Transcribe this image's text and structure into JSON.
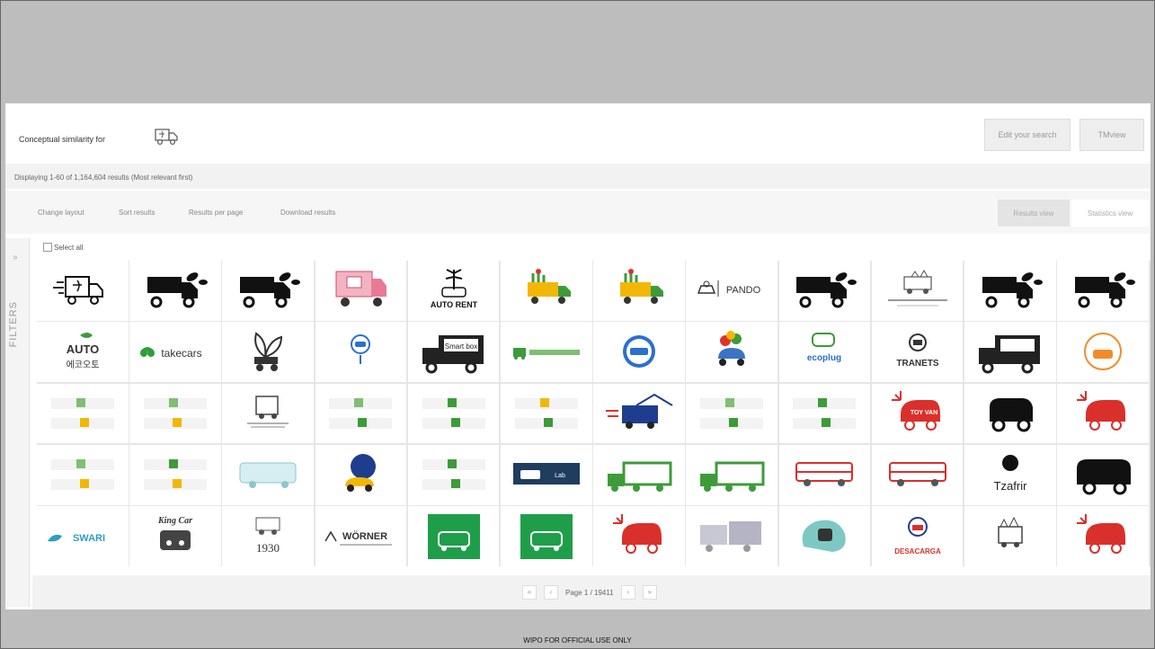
{
  "similarity": {
    "label": "Conceptual similarity for",
    "edit_button": "Edit your search",
    "tmview_button": "TMview"
  },
  "results": {
    "summary": "Displaying 1-60 of 1,164,604 results (Most relevant first)"
  },
  "toolbar": {
    "change_layout": "Change layout",
    "sort_results": "Sort results",
    "results_per_page": "Results per page",
    "download_results": "Download results",
    "results_view": "Results view",
    "statistics_view": "Statistics view"
  },
  "filters": {
    "label": "FILTERS",
    "chevron": "»"
  },
  "select_all": "Select all",
  "grid": {
    "logo_texts": {
      "pando": "PANDO",
      "takecars": "takecars",
      "auto": "AUTO",
      "auto_korean": "에코오토",
      "tranets": "TRANETS",
      "tzafrir": "Tzafrir",
      "swari": "SWARI",
      "king_car": "King Car",
      "year": "1930",
      "worner": "WÖRNER",
      "desacarga": "DESACARGA",
      "auto_rent": "AUTO RENT",
      "ecoplug": "ecoplug",
      "smart_box": "Smart box",
      "toy_van": "TOY VAN",
      "lab": "Lab"
    }
  },
  "pager": {
    "first": "«",
    "prev": "‹",
    "page_text": "Page 1 / 19411",
    "next": "›",
    "last": "»"
  },
  "footer": {
    "text": "WIPO FOR OFFICIAL USE ONLY"
  },
  "colors": {
    "green": "#2e9e3a",
    "red": "#d9302b",
    "blue": "#2b6fd1",
    "black": "#111111"
  }
}
